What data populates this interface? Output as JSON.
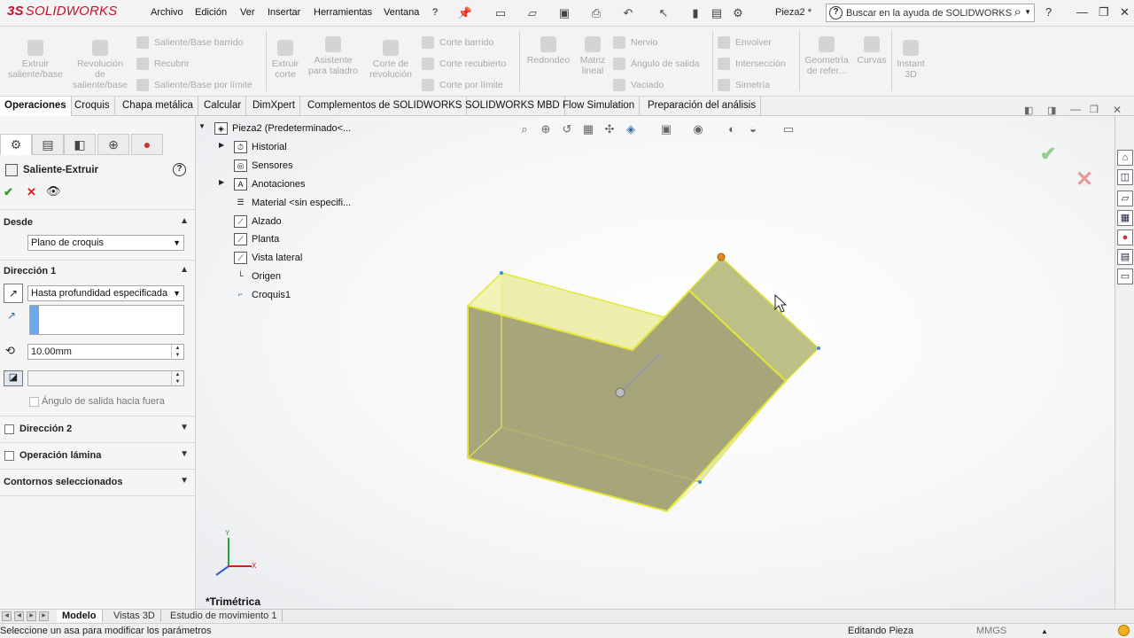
{
  "app": {
    "logo_prefix": "3S",
    "logo_text": "SOLIDWORKS",
    "document_title": "Pieza2 *"
  },
  "menu": [
    "Archivo",
    "Edición",
    "Ver",
    "Insertar",
    "Herramientas",
    "Ventana",
    "?"
  ],
  "search": {
    "placeholder": "Buscar en la ayuda de SOLIDWORKS"
  },
  "commands": {
    "extrude_boss": "Extruir saliente/base",
    "revolve_boss": "Revolución de saliente/base",
    "sweep_boss": "Saliente/Base barrido",
    "loft_boss": "Recubrir",
    "boundary_boss": "Saliente/Base por límite",
    "extrude_cut": "Extruir corte",
    "hole_wizard": "Asistente para taladro",
    "revolve_cut": "Corte de revolución",
    "sweep_cut": "Corte barrido",
    "loft_cut": "Corte recubierto",
    "boundary_cut": "Corte por límite",
    "fillet": "Redondeo",
    "linear_pattern": "Matriz lineal",
    "rib": "Nervio",
    "draft": "Ángulo de salida",
    "shell": "Vaciado",
    "wrap": "Envolver",
    "intersect": "Intersección",
    "mirror": "Simetría",
    "ref_geometry": "Geometría de refer...",
    "curves": "Curvas",
    "instant3d": "Instant 3D"
  },
  "tabs": [
    "Operaciones",
    "Croquis",
    "Chapa metálica",
    "Calcular",
    "DimXpert",
    "Complementos de SOLIDWORKS",
    "SOLIDWORKS MBD",
    "Flow Simulation",
    "Preparación del análisis"
  ],
  "property_manager": {
    "title": "Saliente-Extruir",
    "from_label": "Desde",
    "from_value": "Plano de croquis",
    "dir1_label": "Dirección 1",
    "dir1_end_condition": "Hasta profundidad especificada",
    "depth_value": "10.00mm",
    "draft_outward_label": "Ángulo de salida hacia fuera",
    "dir2_label": "Dirección 2",
    "thin_feature_label": "Operación lámina",
    "selected_contours_label": "Contornos seleccionados"
  },
  "feature_tree": {
    "root": "Pieza2  (Predeterminado<...",
    "items": [
      "Historial",
      "Sensores",
      "Anotaciones",
      "Material <sin especifi...",
      "Alzado",
      "Planta",
      "Vista lateral",
      "Origen",
      "Croquis1"
    ]
  },
  "viewport": {
    "view_label": "*Trimétrica",
    "triad_x": "X",
    "triad_y": "Y"
  },
  "bottom_tabs": [
    "Modelo",
    "Vistas 3D",
    "Estudio de movimiento 1"
  ],
  "status": {
    "message": "Seleccione un asa para modificar los parámetros",
    "mode": "Editando Pieza",
    "units": "MMGS"
  },
  "colors": {
    "brand": "#c8102e",
    "accept_green": "#2e9e2e",
    "cancel_red": "#d62020",
    "preview_fill": "#d9dd9a",
    "preview_edge": "#e6e63a",
    "selection_blue": "#3b8fe0"
  }
}
